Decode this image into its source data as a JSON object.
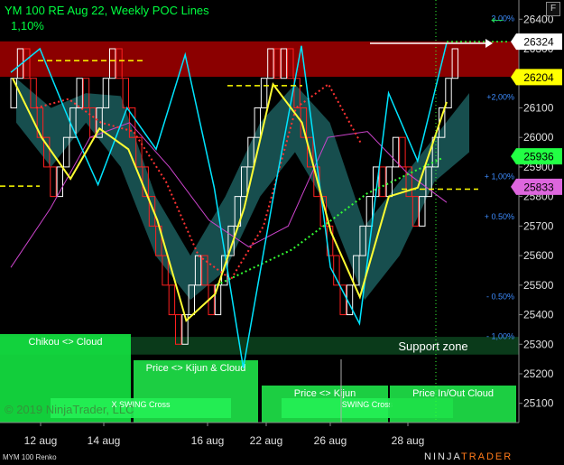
{
  "header": {
    "title": "YM 100 RE Aug 22, Weekly POC Lines",
    "subtitle": "1,10%",
    "flag_label": "F"
  },
  "footer": {
    "copyright": "© 2019 NinjaTrader, LLC",
    "instrument": "MYM 100 Renko",
    "logo_left": "NINJA",
    "logo_right": "TRADER"
  },
  "colors": {
    "background": "#000000",
    "resistance_band": "#8b0000",
    "support_band": "#0a3a1a",
    "bull_brick": "#ffffff",
    "bear_brick": "#ff2020",
    "price_line": "#00e5ff",
    "kijun_line": "#ffff33",
    "tenkan_dotted_red": "#ff3333",
    "tenkan_dotted_green": "#33ff33",
    "magenta_line": "#cc44cc",
    "cloud": "#1b5c5c",
    "poc_dashed": "#ffff00",
    "current_price_box": "#ffffff",
    "label_yellow": "#ffff00",
    "label_green": "#22ff44",
    "label_violet": "#dd66dd"
  },
  "chart_data": {
    "type": "renko",
    "title": "YM 100 RE Aug 22, Weekly POC Lines",
    "subtitle": "1,10%",
    "y_range": [
      25035,
      26465
    ],
    "y_ticks": [
      25100,
      25200,
      25300,
      25400,
      25500,
      25600,
      25700,
      25800,
      25900,
      26000,
      26100,
      26200,
      26300,
      26400
    ],
    "x_tick_labels": [
      "12 aug",
      "14 aug",
      "16 aug",
      "22 aug",
      "26 aug",
      "28 aug"
    ],
    "price_labels": [
      {
        "value": 26324,
        "text": "26324",
        "style": "white"
      },
      {
        "value": 26204,
        "text": "26204",
        "style": "yellow"
      },
      {
        "value": 25936,
        "text": "25936",
        "style": "green"
      },
      {
        "value": 25833,
        "text": "25833",
        "style": "violet"
      }
    ],
    "percent_levels": [
      {
        "text": "3.00%",
        "value": 26405
      },
      {
        "text": "+2,00%",
        "value": 26140
      },
      {
        "text": "+ 1,00%",
        "value": 25870
      },
      {
        "text": "+ 0.50%",
        "value": 25735
      },
      {
        "text": "- 0.50%",
        "value": 25465
      },
      {
        "text": "- 1,00%",
        "value": 25330
      }
    ],
    "zones": [
      {
        "label": "",
        "y_from": 26205,
        "y_to": 26325,
        "kind": "resistance"
      },
      {
        "label": "Support zone",
        "y_from": 25265,
        "y_to": 25325,
        "kind": "support"
      }
    ],
    "poc_levels": [
      26260,
      26175,
      25835
    ],
    "current_price": 26324,
    "bricks": [
      {
        "c": 26200,
        "d": "up"
      },
      {
        "c": 26300,
        "d": "up"
      },
      {
        "c": 26200,
        "d": "dn"
      },
      {
        "c": 26100,
        "d": "dn"
      },
      {
        "c": 26000,
        "d": "dn"
      },
      {
        "c": 25900,
        "d": "dn"
      },
      {
        "c": 25800,
        "d": "dn"
      },
      {
        "c": 25900,
        "d": "up"
      },
      {
        "c": 26000,
        "d": "up"
      },
      {
        "c": 26100,
        "d": "up"
      },
      {
        "c": 26200,
        "d": "up"
      },
      {
        "c": 26100,
        "d": "dn"
      },
      {
        "c": 26000,
        "d": "dn"
      },
      {
        "c": 26100,
        "d": "up"
      },
      {
        "c": 26200,
        "d": "up"
      },
      {
        "c": 26300,
        "d": "up"
      },
      {
        "c": 26200,
        "d": "dn"
      },
      {
        "c": 26100,
        "d": "dn"
      },
      {
        "c": 26000,
        "d": "dn"
      },
      {
        "c": 25900,
        "d": "dn"
      },
      {
        "c": 25800,
        "d": "dn"
      },
      {
        "c": 25700,
        "d": "dn"
      },
      {
        "c": 25600,
        "d": "dn"
      },
      {
        "c": 25500,
        "d": "dn"
      },
      {
        "c": 25400,
        "d": "dn"
      },
      {
        "c": 25300,
        "d": "dn"
      },
      {
        "c": 25400,
        "d": "up"
      },
      {
        "c": 25500,
        "d": "up"
      },
      {
        "c": 25600,
        "d": "up"
      },
      {
        "c": 25500,
        "d": "dn"
      },
      {
        "c": 25400,
        "d": "dn"
      },
      {
        "c": 25500,
        "d": "up"
      },
      {
        "c": 25600,
        "d": "up"
      },
      {
        "c": 25700,
        "d": "up"
      },
      {
        "c": 25800,
        "d": "up"
      },
      {
        "c": 25900,
        "d": "up"
      },
      {
        "c": 26000,
        "d": "up"
      },
      {
        "c": 26100,
        "d": "up"
      },
      {
        "c": 26200,
        "d": "up"
      },
      {
        "c": 26300,
        "d": "up"
      },
      {
        "c": 26200,
        "d": "dn"
      },
      {
        "c": 26300,
        "d": "up"
      },
      {
        "c": 26200,
        "d": "dn"
      },
      {
        "c": 26100,
        "d": "dn"
      },
      {
        "c": 26000,
        "d": "dn"
      },
      {
        "c": 25900,
        "d": "dn"
      },
      {
        "c": 25800,
        "d": "dn"
      },
      {
        "c": 25700,
        "d": "dn"
      },
      {
        "c": 25600,
        "d": "dn"
      },
      {
        "c": 25500,
        "d": "dn"
      },
      {
        "c": 25400,
        "d": "dn"
      },
      {
        "c": 25500,
        "d": "up"
      },
      {
        "c": 25600,
        "d": "up"
      },
      {
        "c": 25700,
        "d": "up"
      },
      {
        "c": 25800,
        "d": "up"
      },
      {
        "c": 25900,
        "d": "up"
      },
      {
        "c": 25800,
        "d": "dn"
      },
      {
        "c": 25900,
        "d": "up"
      },
      {
        "c": 26000,
        "d": "up"
      },
      {
        "c": 25900,
        "d": "dn"
      },
      {
        "c": 25800,
        "d": "dn"
      },
      {
        "c": 25700,
        "d": "dn"
      },
      {
        "c": 25800,
        "d": "up"
      },
      {
        "c": 25900,
        "d": "up"
      },
      {
        "c": 26000,
        "d": "up"
      },
      {
        "c": 26100,
        "d": "up"
      },
      {
        "c": 26200,
        "d": "up"
      },
      {
        "c": 26300,
        "d": "up"
      }
    ],
    "price_line": [
      26220,
      26300,
      26060,
      25840,
      26100,
      25960,
      26280,
      25830,
      25220,
      25780,
      26310,
      25560,
      25370,
      26150,
      25920,
      26320
    ],
    "kijun_line": [
      26200,
      26000,
      25860,
      26030,
      25960,
      25720,
      25380,
      25470,
      25760,
      26180,
      26050,
      25680,
      25460,
      25800,
      25830,
      26120
    ],
    "red_dotted": [
      26100,
      26130,
      26050,
      26020,
      25850,
      25600,
      25520,
      25700,
      26100,
      26180,
      25980
    ],
    "green_dotted": [
      25500,
      25620,
      25810,
      25930
    ],
    "magenta_line": [
      25560,
      25760,
      26000,
      26050,
      25900,
      25720,
      25630,
      25700,
      26000,
      26020,
      25880,
      25780
    ],
    "cloud_band": [
      {
        "top": 26200,
        "bottom": 26050
      },
      {
        "top": 26100,
        "bottom": 25900
      },
      {
        "top": 26150,
        "bottom": 26050
      },
      {
        "top": 26140,
        "bottom": 25900
      },
      {
        "top": 25800,
        "bottom": 25600
      },
      {
        "top": 25600,
        "bottom": 25450
      },
      {
        "top": 25800,
        "bottom": 25550
      },
      {
        "top": 26050,
        "bottom": 25800
      },
      {
        "top": 26180,
        "bottom": 25950
      },
      {
        "top": 26050,
        "bottom": 25750
      },
      {
        "top": 25700,
        "bottom": 25450
      },
      {
        "top": 25850,
        "bottom": 25600
      },
      {
        "top": 26000,
        "bottom": 25850
      },
      {
        "top": 26150,
        "bottom": 25950
      }
    ],
    "signal_panels": [
      {
        "label": "Chikou <> Cloud",
        "level": 1
      },
      {
        "label": "Price <> Kijun & Cloud",
        "level": 2
      },
      {
        "label": "X SWING Cross",
        "level": 3
      },
      {
        "label": "Price <> Kijun",
        "level": 2
      },
      {
        "label": "SWING Cross",
        "level": 3
      },
      {
        "label": "Price In/Out Cloud",
        "level": 2
      }
    ]
  }
}
